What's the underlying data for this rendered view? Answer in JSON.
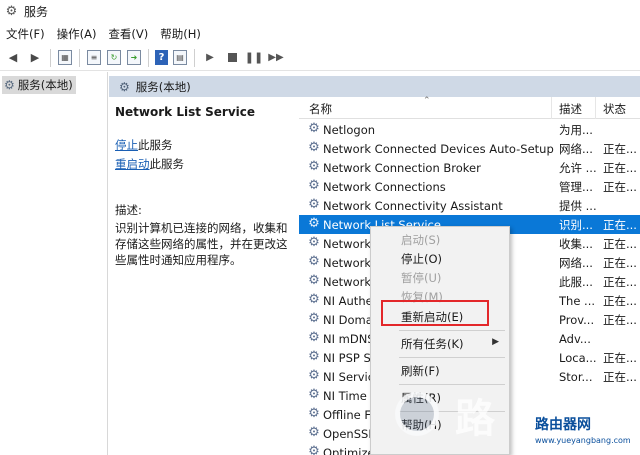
{
  "window": {
    "title": "服务",
    "icon": "gear-icon"
  },
  "menubar": [
    "文件(F)",
    "操作(A)",
    "查看(V)",
    "帮助(H)"
  ],
  "toolbar": {
    "icons": [
      "back-arrow-icon",
      "forward-arrow-icon",
      "show-pane-icon",
      "properties-icon",
      "refresh-icon",
      "export-icon",
      "help-icon",
      "details-icon",
      "start-service-icon",
      "stop-service-icon",
      "pause-service-icon",
      "restart-service-icon"
    ]
  },
  "tree": {
    "item_label": "服务(本地)"
  },
  "panel": {
    "header": "服务(本地)",
    "service_title": "Network List Service",
    "stop_link": "停止",
    "stop_suffix": "此服务",
    "restart_link": "重启动",
    "restart_suffix": "此服务",
    "desc_label": "描述:",
    "desc_text": "识别计算机已连接的网络，收集和存储这些网络的属性，并在更改这些属性时通知应用程序。"
  },
  "columns": {
    "name": "名称",
    "description": "描述",
    "status": "状态"
  },
  "services": [
    {
      "name": "Netlogon",
      "desc": "为用...",
      "status": ""
    },
    {
      "name": "Network Connected Devices Auto-Setup",
      "desc": "网络...",
      "status": "正在..."
    },
    {
      "name": "Network Connection Broker",
      "desc": "允许 ...",
      "status": "正在..."
    },
    {
      "name": "Network Connections",
      "desc": "管理...",
      "status": "正在..."
    },
    {
      "name": "Network Connectivity Assistant",
      "desc": "提供 ...",
      "status": ""
    },
    {
      "name": "Network List Service",
      "desc": "识别...",
      "status": "正在...",
      "selected": true
    },
    {
      "name": "Network",
      "desc": "收集...",
      "status": "正在..."
    },
    {
      "name": "Network",
      "desc": "网络...",
      "status": "正在..."
    },
    {
      "name": "Network",
      "desc": "此服...",
      "status": "正在..."
    },
    {
      "name": "NI Authe",
      "desc": "The ...",
      "status": "正在..."
    },
    {
      "name": "NI Doma",
      "desc": "Prov...",
      "status": "正在..."
    },
    {
      "name": "NI mDNS",
      "desc": "Adv...",
      "status": ""
    },
    {
      "name": "NI PSP S",
      "desc": "Loca...",
      "status": "正在..."
    },
    {
      "name": "NI Servic",
      "desc": "Stor...",
      "status": "正在..."
    },
    {
      "name": "NI Time",
      "desc": "",
      "status": ""
    },
    {
      "name": "Offline Fi",
      "desc": "",
      "status": ""
    },
    {
      "name": "OpenSSH Authentication Agent",
      "desc": "",
      "status": ""
    },
    {
      "name": "Optimize drives",
      "desc": "",
      "status": ""
    }
  ],
  "context_menu": {
    "start": "启动(S)",
    "stop": "停止(O)",
    "pause": "暂停(U)",
    "resume": "恢复(M)",
    "restart": "重新启动(E)",
    "all_tasks": "所有任务(K)",
    "refresh": "刷新(F)",
    "properties": "属性(R)",
    "help": "帮助(H)"
  },
  "watermark": {
    "big": "路",
    "brand": "路由器网",
    "url": "www.yueyangbang.com"
  },
  "colors": {
    "selection": "#0a78d7",
    "header_band": "#cfd9e6",
    "highlight_box": "#e3272a",
    "link": "#1a5fb4"
  }
}
